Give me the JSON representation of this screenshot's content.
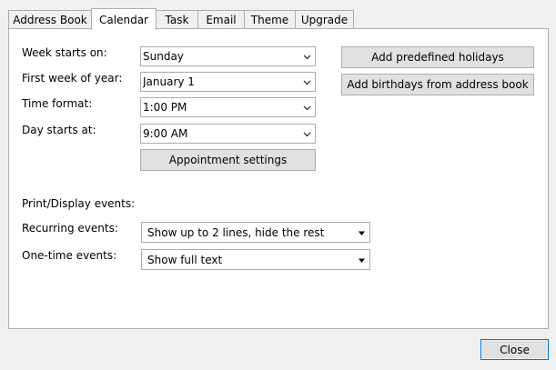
{
  "tabs": [
    "Address Book",
    "Calendar",
    "Task",
    "Email",
    "Theme",
    "Upgrade"
  ],
  "active_tab": "Calendar",
  "fields": {
    "week_starts_on": {
      "label": "Week starts on:",
      "value": "Sunday"
    },
    "first_week_of_year": {
      "label": "First week of year:",
      "value": "January 1"
    },
    "time_format": {
      "label": "Time format:",
      "value": "1:00 PM"
    },
    "day_starts_at": {
      "label": "Day starts at:",
      "value": "9:00 AM"
    }
  },
  "buttons": {
    "appointment_settings": "Appointment settings",
    "add_predefined_holidays": "Add predefined holidays",
    "add_birthdays": "Add birthdays from address book",
    "close": "Close"
  },
  "print_display": {
    "heading": "Print/Display events:",
    "recurring": {
      "label": "Recurring events:",
      "value": "Show up to 2 lines, hide the rest"
    },
    "one_time": {
      "label": "One-time events:",
      "value": "Show full text"
    }
  },
  "icons": {
    "dropdown": "chevron-down-icon"
  }
}
